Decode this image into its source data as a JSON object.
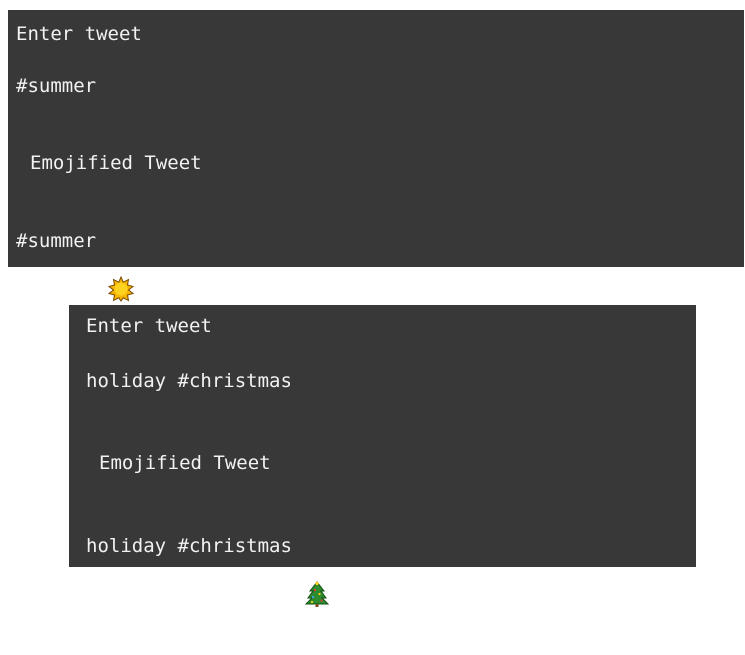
{
  "panels": [
    {
      "input_label": "Enter tweet",
      "input_value": "#summer",
      "output_label": "Emojified Tweet",
      "output_value": "#summer",
      "output_emoji": "sun-icon"
    },
    {
      "input_label": "Enter tweet",
      "input_value": "holiday #christmas",
      "output_label": "Emojified Tweet",
      "output_value": "holiday #christmas",
      "output_emoji": "christmas-tree-icon"
    }
  ],
  "colors": {
    "panel_background": "#383838",
    "text": "#f2f2f2"
  }
}
